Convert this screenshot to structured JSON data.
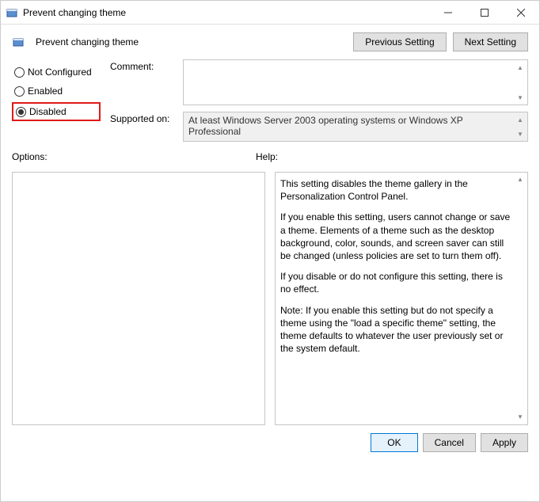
{
  "titlebar": {
    "title": "Prevent changing theme"
  },
  "header": {
    "policy_title": "Prevent changing theme",
    "previous": "Previous Setting",
    "next": "Next Setting"
  },
  "radios": {
    "not_configured": "Not Configured",
    "enabled": "Enabled",
    "disabled": "Disabled"
  },
  "fields": {
    "comment_label": "Comment:",
    "comment_value": "",
    "supported_label": "Supported on:",
    "supported_value": "At least Windows Server 2003 operating systems or Windows XP Professional"
  },
  "lower": {
    "options_label": "Options:",
    "help_label": "Help:"
  },
  "help": {
    "p1": "This setting disables the theme gallery in the Personalization Control Panel.",
    "p2": "If you enable this setting, users cannot change or save a theme. Elements of a theme such as the desktop background, color, sounds, and screen saver can still be changed (unless policies are set to turn them off).",
    "p3": "If you disable or do not configure this setting, there is no effect.",
    "p4": "Note: If you enable this setting but do not specify a theme using the \"load a specific theme\" setting, the theme defaults to whatever the user previously set or the system default."
  },
  "footer": {
    "ok": "OK",
    "cancel": "Cancel",
    "apply": "Apply"
  }
}
